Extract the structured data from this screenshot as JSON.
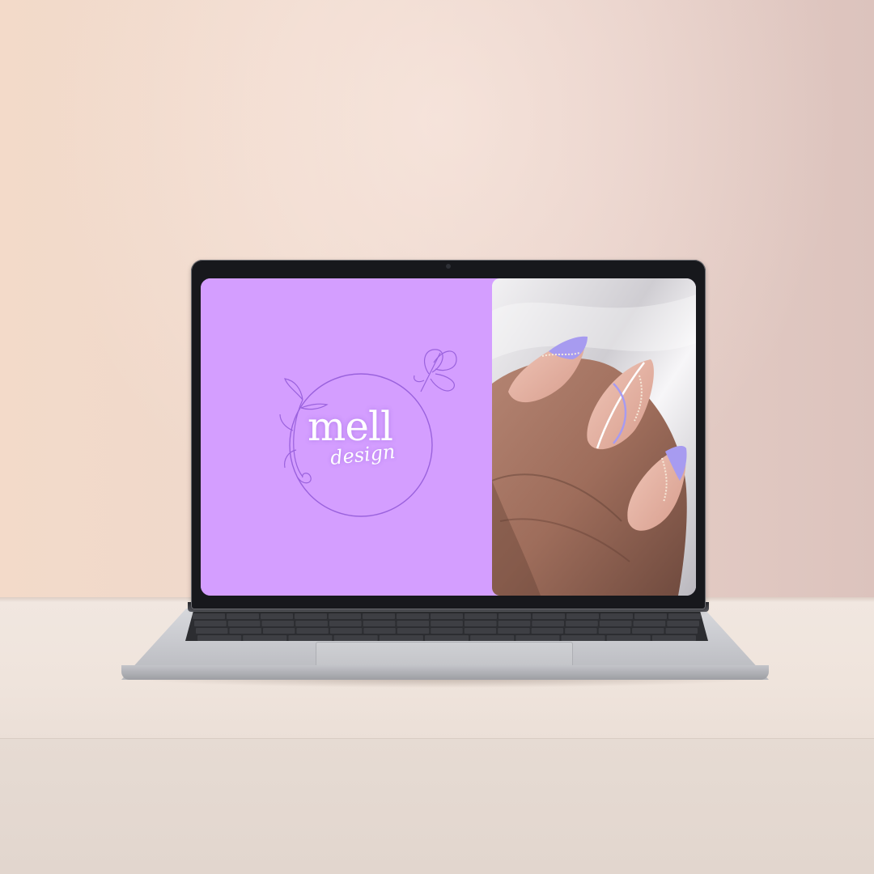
{
  "logo": {
    "brand_main": "mell",
    "brand_sub": "design"
  },
  "colors": {
    "screen_panel": "#d49eff",
    "logo_line": "#9a62dd",
    "nail_lavender": "#a79bf0",
    "nail_base": "#e3b2a4"
  },
  "icons": {
    "butterfly": "butterfly-icon",
    "vine": "vine-icon"
  }
}
